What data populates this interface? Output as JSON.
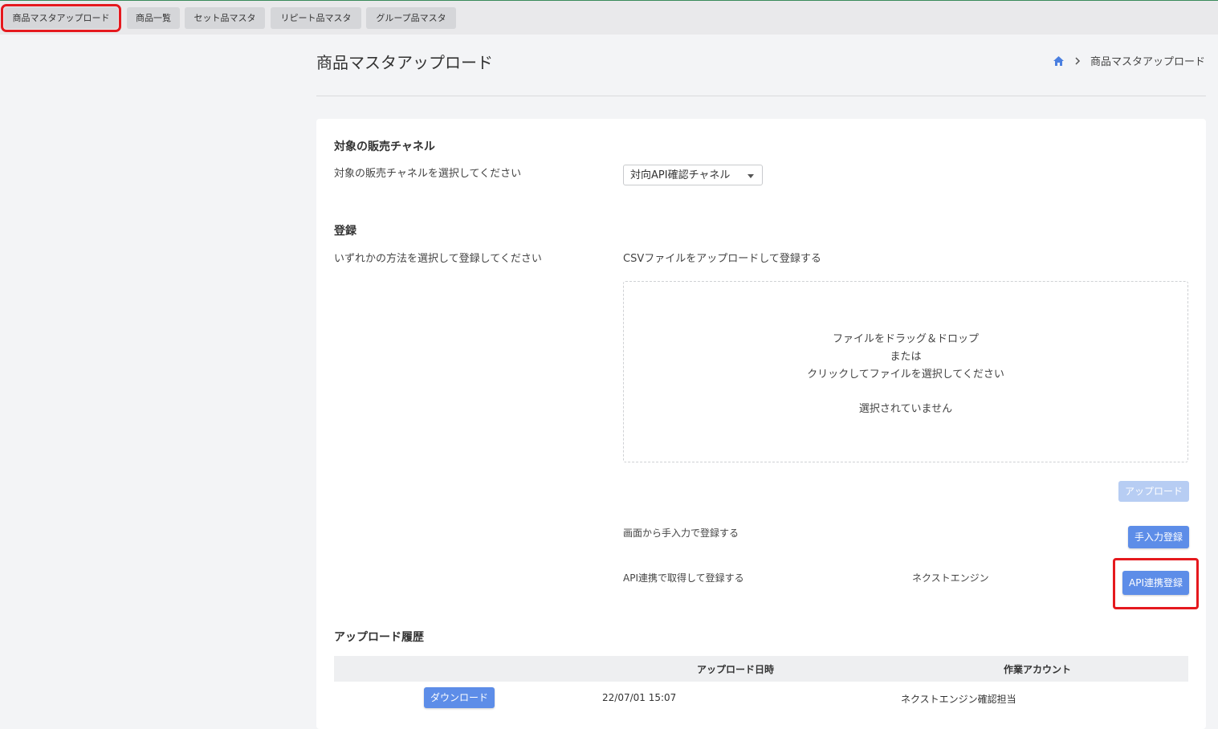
{
  "tabs": [
    {
      "label": "商品マスタアップロード"
    },
    {
      "label": "商品一覧"
    },
    {
      "label": "セット品マスタ"
    },
    {
      "label": "リピート品マスタ"
    },
    {
      "label": "グループ品マスタ"
    }
  ],
  "header": {
    "title": "商品マスタアップロード",
    "breadcrumb_current": "商品マスタアップロード"
  },
  "channel": {
    "section_title": "対象の販売チャネル",
    "instruction": "対象の販売チャネルを選択してください",
    "selected": "対向API確認チャネル"
  },
  "register": {
    "section_title": "登録",
    "instruction": "いずれかの方法を選択して登録してください",
    "csv_label": "CSVファイルをアップロードして登録する",
    "dropzone": {
      "line1": "ファイルをドラッグ＆ドロップ",
      "line2": "または",
      "line3": "クリックしてファイルを選択してください",
      "status": "選択されていません"
    },
    "upload_button": "アップロード",
    "manual_label": "画面から手入力で登録する",
    "manual_button": "手入力登録",
    "api_label": "API連携で取得して登録する",
    "api_service": "ネクストエンジン",
    "api_button": "API連携登録"
  },
  "history": {
    "section_title": "アップロード履歴",
    "columns": [
      "アップロード日時",
      "作業アカウント"
    ],
    "rows": [
      {
        "button": "ダウンロード",
        "datetime": "22/07/01 15:07",
        "account": "ネクストエンジン確認担当"
      }
    ]
  },
  "colors": {
    "primary": "#5d8de8",
    "highlight": "#e5191e",
    "home_icon": "#4a7fe0"
  }
}
